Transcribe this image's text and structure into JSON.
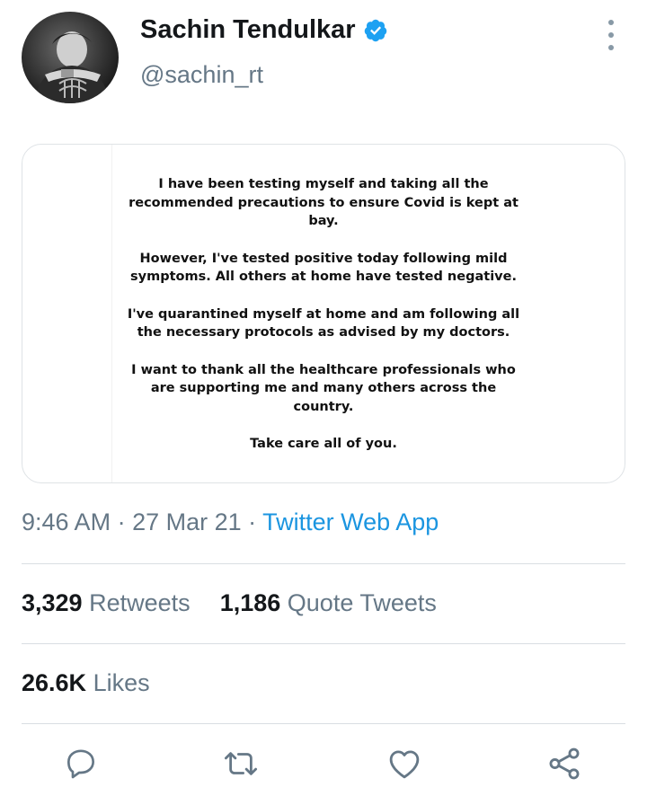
{
  "author": {
    "display_name": "Sachin Tendulkar",
    "handle": "@sachin_rt",
    "verified": true,
    "avatar_icon": "profile-photo"
  },
  "media": {
    "paragraphs": [
      "I have been testing myself and taking all the\nrecommended precautions to ensure Covid is kept at\nbay.",
      "However, I've tested positive today following mild\nsymptoms. All others at home have tested negative.",
      "I've quarantined myself at home and am following all\nthe necessary protocols as advised by my doctors.",
      "I want to thank all the healthcare professionals who\nare supporting me and many others across the\ncountry.",
      "Take care all of you."
    ]
  },
  "meta": {
    "time": "9:46 AM",
    "separator_1": " · ",
    "date": "27 Mar 21",
    "separator_2": " · ",
    "source": "Twitter Web App"
  },
  "stats": {
    "retweets_count": "3,329",
    "retweets_label": "Retweets",
    "quotes_count": "1,186",
    "quotes_label": "Quote Tweets",
    "likes_count": "26.6K",
    "likes_label": "Likes"
  },
  "actions": {
    "icons": [
      "reply-icon",
      "retweet-icon",
      "like-icon",
      "share-icon"
    ]
  },
  "colors": {
    "accent": "#1b95e0",
    "secondary_text": "#657786",
    "icon_gray": "#657786",
    "divider": "#d9dee2",
    "verified_badge": "#1da1f2"
  }
}
